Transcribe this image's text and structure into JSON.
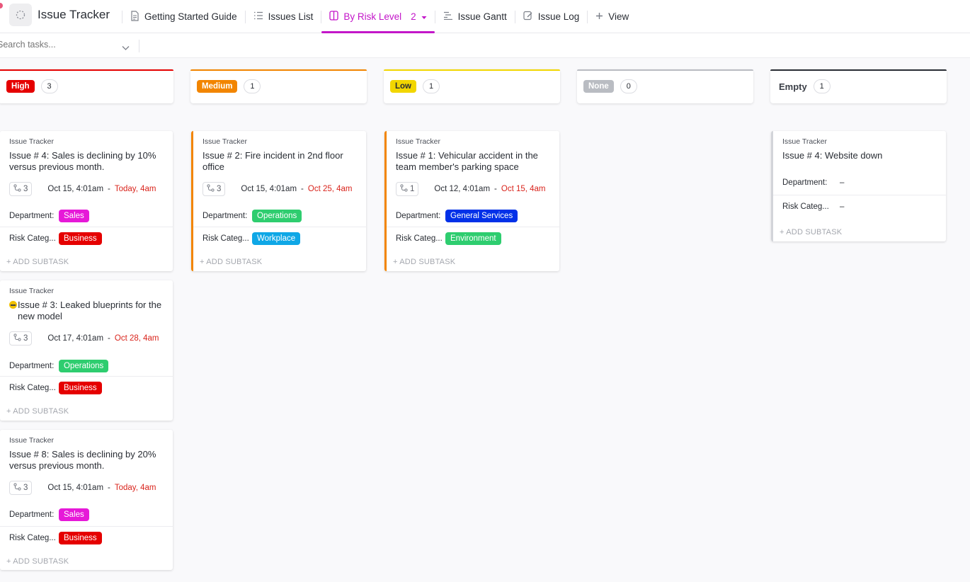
{
  "header": {
    "app_title": "Issue Tracker",
    "tabs": [
      {
        "label": "Getting Started Guide",
        "icon": "doc-icon"
      },
      {
        "label": "Issues List",
        "icon": "list-icon"
      },
      {
        "label": "By Risk Level",
        "icon": "board-icon",
        "count": "2",
        "active": true
      },
      {
        "label": "Issue Gantt",
        "icon": "gantt-icon"
      },
      {
        "label": "Issue Log",
        "icon": "form-icon"
      },
      {
        "label": "View",
        "icon": "plus-icon"
      }
    ]
  },
  "toolbar": {
    "search_placeholder": "Search tasks..."
  },
  "columns": [
    {
      "label": "High",
      "count": "3",
      "color": "#e50000"
    },
    {
      "label": "Medium",
      "count": "1",
      "color": "#f28500"
    },
    {
      "label": "Low",
      "count": "1",
      "color": "#f2d600"
    },
    {
      "label": "None",
      "count": "0",
      "color": "#b9bcc2"
    },
    {
      "label": "Empty",
      "count": "1",
      "color": "#292d34"
    }
  ],
  "cards": [
    {
      "list": "Issue Tracker",
      "title": "Issue # 4: Sales is declining by 10% versus previous month.",
      "subtasks": "3",
      "start": "Oct 15, 4:01am",
      "due": "Today, 4am",
      "department_label": "Department:",
      "department": "Sales",
      "department_color": "#e619d8",
      "risk_label": "Risk Categ...",
      "risk": "Business",
      "risk_color": "#e50000",
      "add": "+ ADD SUBTASK"
    },
    {
      "list": "Issue Tracker",
      "title": "Issue # 3: Leaked blueprints for the new model",
      "subtasks": "3",
      "start": "Oct 17, 4:01am",
      "due": "Oct 28, 4am",
      "department_label": "Department:",
      "department": "Operations",
      "department_color": "#2ecd6f",
      "risk_label": "Risk Categ...",
      "risk": "Business",
      "risk_color": "#e50000",
      "add": "+ ADD SUBTASK"
    },
    {
      "list": "Issue Tracker",
      "title": "Issue # 8: Sales is declining by 20% versus previous month.",
      "subtasks": "3",
      "start": "Oct 15, 4:01am",
      "due": "Today, 4am",
      "department_label": "Department:",
      "department": "Sales",
      "department_color": "#e619d8",
      "risk_label": "Risk Categ...",
      "risk": "Business",
      "risk_color": "#e50000",
      "add": "+ ADD SUBTASK"
    },
    {
      "list": "Issue Tracker",
      "title": "Issue # 2: Fire incident in 2nd floor office",
      "subtasks": "3",
      "start": "Oct 15, 4:01am",
      "due": "Oct 25, 4am",
      "department_label": "Department:",
      "department": "Operations",
      "department_color": "#2ecd6f",
      "risk_label": "Risk Categ...",
      "risk": "Workplace",
      "risk_color": "#0fa7e6",
      "add": "+ ADD SUBTASK"
    },
    {
      "list": "Issue Tracker",
      "title": "Issue # 1: Vehicular accident in the team member's parking space",
      "subtasks": "1",
      "start": "Oct 12, 4:01am",
      "due": "Oct 15, 4am",
      "department_label": "Department:",
      "department": "General Services",
      "department_color": "#0231e8",
      "risk_label": "Risk Categ...",
      "risk": "Environment",
      "risk_color": "#2ecd6f",
      "add": "+ ADD SUBTASK"
    },
    {
      "list": "Issue Tracker",
      "title": "Issue # 4: Website down",
      "department_label": "Department:",
      "department": "–",
      "risk_label": "Risk Categ...",
      "risk": "–",
      "add": "+ ADD SUBTASK"
    }
  ]
}
